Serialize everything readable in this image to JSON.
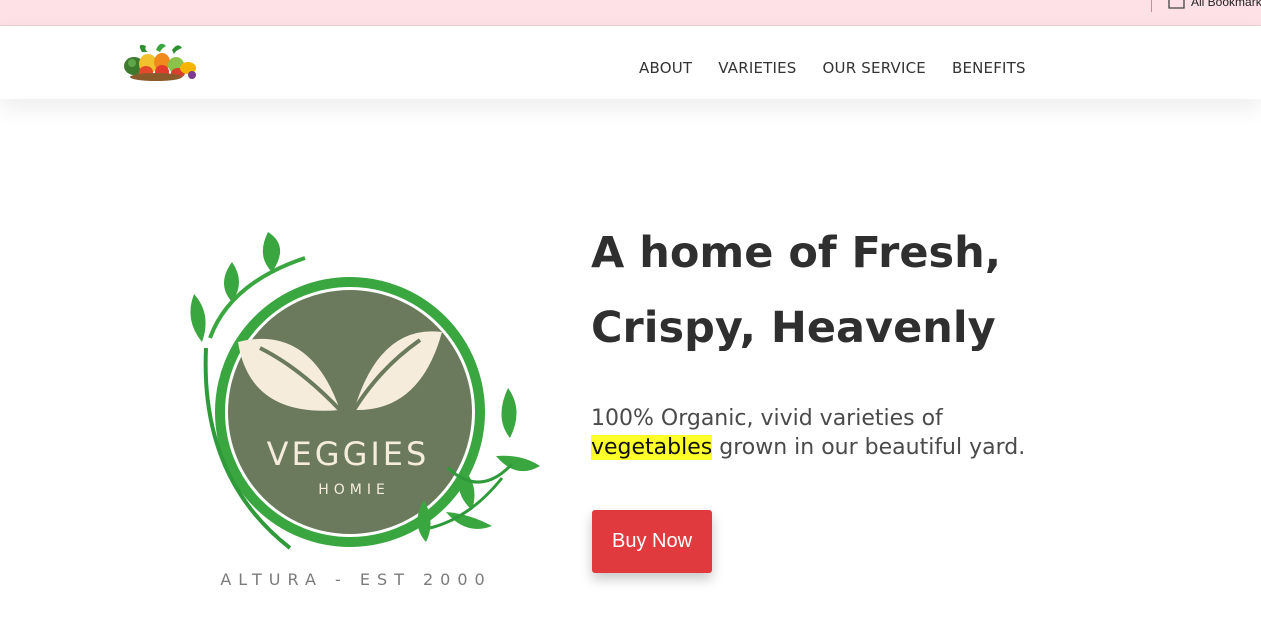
{
  "bookmarks_bar": {
    "all_bookmarks_label": "All Bookmarks",
    "icon": "folder-icon"
  },
  "nav": {
    "logo": "vegetables-basket-logo",
    "links": [
      "ABOUT",
      "VARIETIES",
      "OUR SERVICE",
      "BENEFITS"
    ]
  },
  "hero": {
    "logo": {
      "brand": "VEGGIES",
      "sub": "HOMIE",
      "tagline": "ALTURA - EST 2000",
      "colors": {
        "circle": "#6b7a5c",
        "ring": "#3aa640",
        "leaf": "#f5ecdc"
      }
    },
    "headline": "A home of Fresh, Crispy, Heavenly",
    "subtitle": {
      "before": "100% Organic, vivid varieties of",
      "highlight": "vegetables",
      "after": " grown in our beautiful yard."
    },
    "cta": "Buy Now"
  },
  "colors": {
    "cta": "#e03a3e",
    "highlight": "#ffff2a",
    "bookmarks_bg": "#fde1e6",
    "text": "#2f2f2f"
  }
}
